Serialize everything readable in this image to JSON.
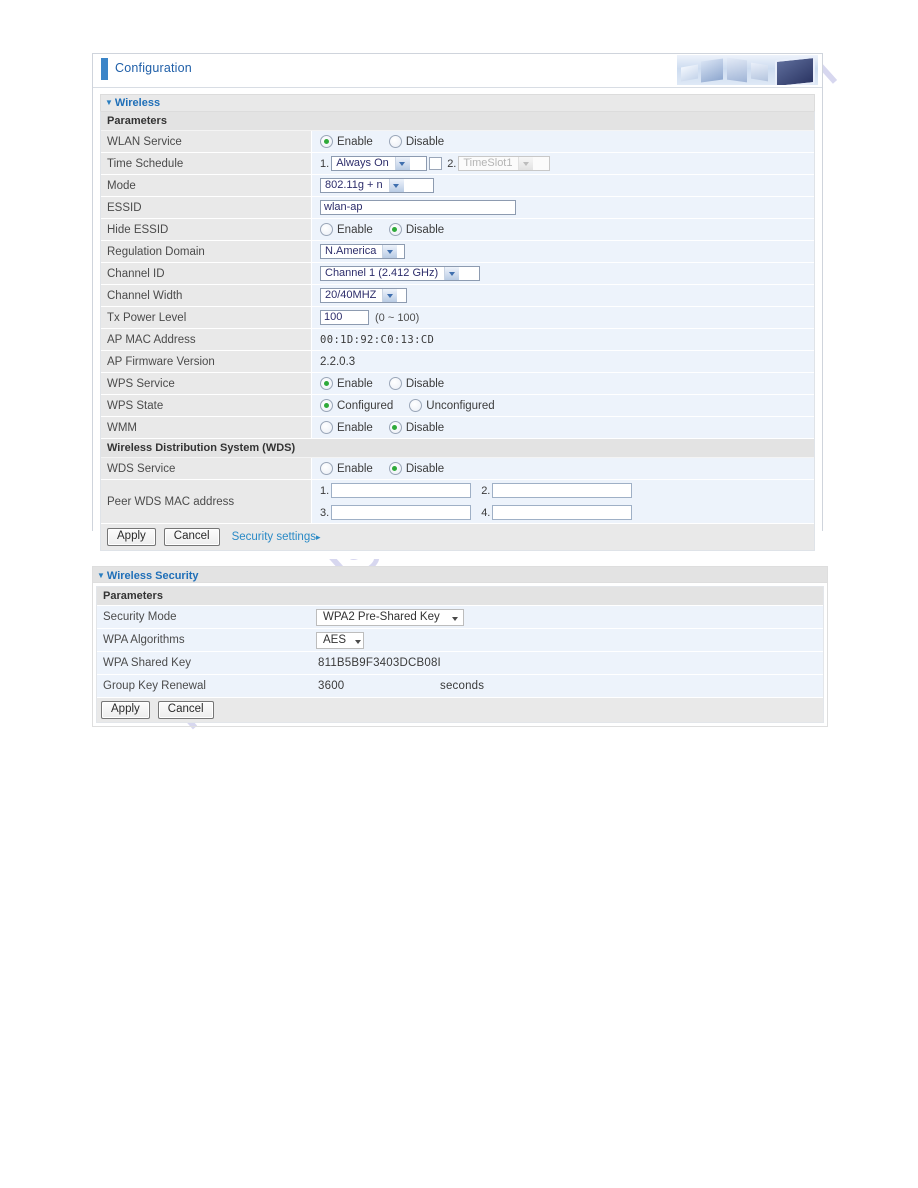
{
  "window": {
    "header_title": "Configuration",
    "header_art": "computer-monitors-graphic"
  },
  "watermark": {
    "text": "manualshive.com"
  },
  "wireless_panel": {
    "section_label": "Wireless",
    "subheading": "Parameters",
    "rows": {
      "wlan_service": {
        "label": "WLAN Service",
        "enable": "Enable",
        "disable": "Disable",
        "selected": "Enable"
      },
      "time_schedule": {
        "label": "Time Schedule",
        "index1": "1.",
        "schedule1": "Always On",
        "index2": "2.",
        "schedule2": "TimeSlot1",
        "checkbox_checked": false
      },
      "mode": {
        "label": "Mode",
        "value": "802.11g + n"
      },
      "essid": {
        "label": "ESSID",
        "value": "wlan-ap"
      },
      "hide_essid": {
        "label": "Hide ESSID",
        "enable": "Enable",
        "disable": "Disable",
        "selected": "Disable"
      },
      "regulation_domain": {
        "label": "Regulation Domain",
        "value": "N.America"
      },
      "channel_id": {
        "label": "Channel ID",
        "value": "Channel 1 (2.412 GHz)"
      },
      "channel_width": {
        "label": "Channel Width",
        "value": "20/40MHZ"
      },
      "tx_power_level": {
        "label": "Tx Power Level",
        "value": "100",
        "hint": "(0 ~ 100)"
      },
      "ap_mac_address": {
        "label": "AP MAC Address",
        "value": "00:1D:92:C0:13:CD"
      },
      "ap_firmware_version": {
        "label": "AP Firmware Version",
        "value": "2.2.0.3"
      },
      "wps_service": {
        "label": "WPS Service",
        "enable": "Enable",
        "disable": "Disable",
        "selected": "Enable"
      },
      "wps_state": {
        "label": "WPS State",
        "configured": "Configured",
        "unconfigured": "Unconfigured",
        "selected": "Configured"
      },
      "wmm": {
        "label": "WMM",
        "enable": "Enable",
        "disable": "Disable",
        "selected": "Disable"
      },
      "wds_heading": "Wireless Distribution System (WDS)",
      "wds_service": {
        "label": "WDS Service",
        "enable": "Enable",
        "disable": "Disable",
        "selected": "Disable"
      },
      "peer_wds": {
        "label": "Peer WDS MAC address",
        "n1": "1.",
        "v1": "",
        "n2": "2.",
        "v2": "",
        "n3": "3.",
        "v3": "",
        "n4": "4.",
        "v4": ""
      }
    },
    "buttons": {
      "apply": "Apply",
      "cancel": "Cancel",
      "security_settings": "Security settings",
      "security_settings_arrow": "▸"
    }
  },
  "security_panel": {
    "section_label": "Wireless Security",
    "subheading": "Parameters",
    "rows": {
      "security_mode": {
        "label": "Security Mode",
        "value": "WPA2 Pre-Shared Key"
      },
      "wpa_algorithms": {
        "label": "WPA Algorithms",
        "value": "AES"
      },
      "wpa_shared_key": {
        "label": "WPA Shared Key",
        "value": "811B5B9F3403DCB08I"
      },
      "group_key_renewal": {
        "label": "Group Key Renewal",
        "value": "3600",
        "unit": "seconds"
      }
    },
    "buttons": {
      "apply": "Apply",
      "cancel": "Cancel"
    }
  },
  "colors": {
    "accent_blue": "#1f6fb8",
    "header_bar": "#3b85c8",
    "radio_on": "#2faa3a",
    "row_bg": "#edf3fb",
    "label_bg": "#e9e9e9",
    "watermark": "#c9c8ea"
  }
}
